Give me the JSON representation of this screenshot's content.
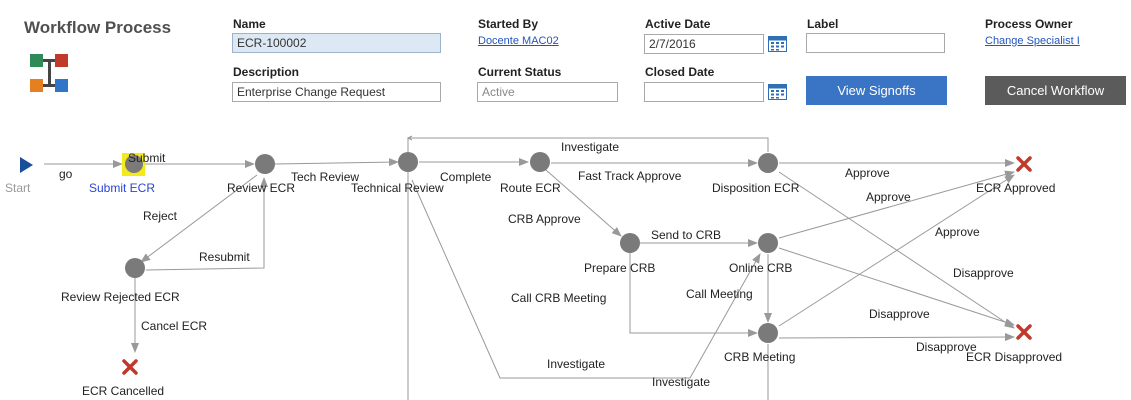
{
  "header": {
    "title": "Workflow Process",
    "logo_icon": "workflow-diagram-icon",
    "name_label": "Name",
    "name_value": "ECR-100002",
    "description_label": "Description",
    "description_value": "Enterprise Change Request",
    "started_by_label": "Started By",
    "started_by_value": "Docente MAC02",
    "current_status_label": "Current Status",
    "current_status_value": "Active",
    "active_date_label": "Active Date",
    "active_date_value": "2/7/2016",
    "closed_date_label": "Closed Date",
    "closed_date_value": "",
    "label_label": "Label",
    "label_value": "",
    "process_owner_label": "Process Owner",
    "process_owner_value": "Change Specialist I",
    "view_signoffs_label": "View Signoffs",
    "cancel_workflow_label": "Cancel Workflow"
  },
  "colors": {
    "node": "#7a7a7a",
    "terminal_x": "#c0392b",
    "start_arrow": "#1a4f9c",
    "active_highlight": "#f2ea1a",
    "edge": "#999999",
    "primary_button": "#3a74c4",
    "secondary_button": "#5b5b5b"
  },
  "diagram": {
    "nodes": {
      "start": "Start",
      "submit_ecr": "Submit ECR",
      "review_ecr": "Review ECR",
      "technical_review": "Technical Review",
      "route_ecr": "Route ECR",
      "disposition_ecr": "Disposition ECR",
      "ecr_approved": "ECR Approved",
      "prepare_crb": "Prepare CRB",
      "online_crb": "Online CRB",
      "crb_meeting": "CRB Meeting",
      "ecr_disapproved": "ECR Disapproved",
      "review_rejected_ecr": "Review Rejected ECR",
      "ecr_cancelled": "ECR Cancelled"
    },
    "edges": {
      "go": "go",
      "submit": "Submit",
      "tech_review": "Tech Review",
      "complete": "Complete",
      "investigate_top": "Investigate",
      "fast_track_approve": "Fast Track Approve",
      "approve_1": "Approve",
      "approve_2": "Approve",
      "approve_3": "Approve",
      "reject": "Reject",
      "resubmit": "Resubmit",
      "crb_approve": "CRB Approve",
      "send_to_crb": "Send to CRB",
      "disapprove_1": "Disapprove",
      "call_crb_meeting": "Call CRB Meeting",
      "call_meeting": "Call Meeting",
      "disapprove_2": "Disapprove",
      "disapprove_3": "Disapprove",
      "cancel_ecr": "Cancel ECR",
      "investigate_mid": "Investigate",
      "investigate_bottom": "Investigate"
    }
  }
}
